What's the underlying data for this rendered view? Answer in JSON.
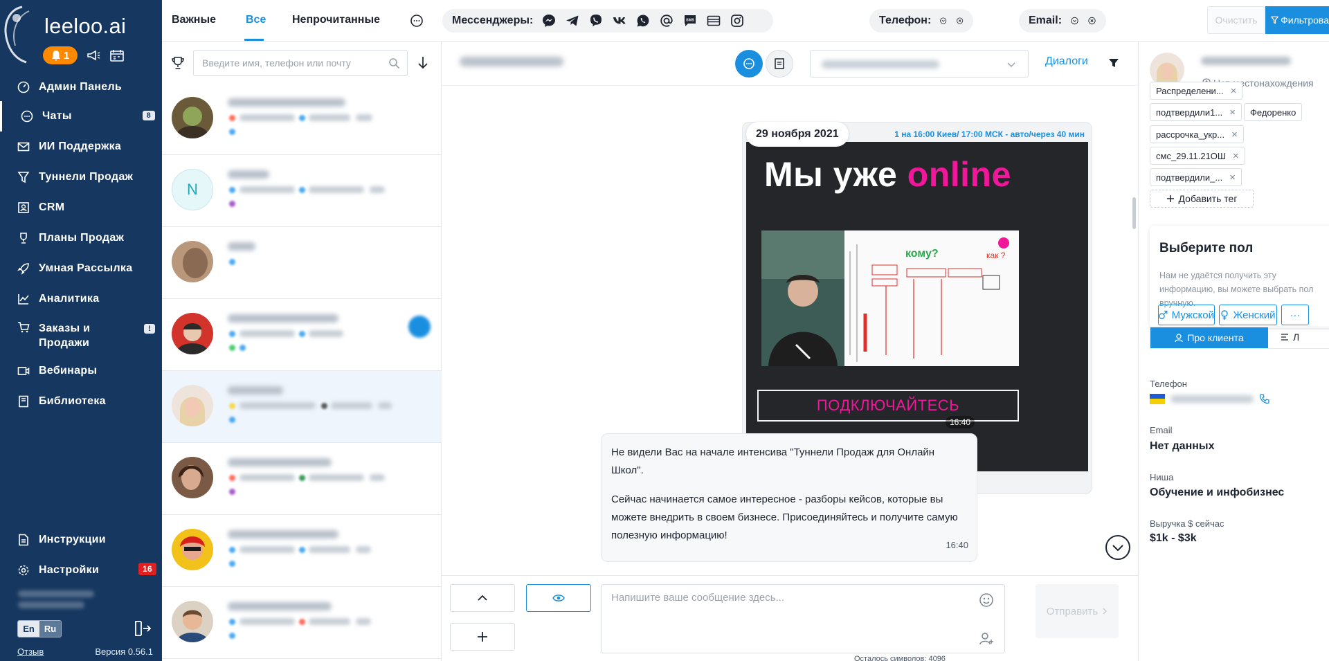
{
  "app": {
    "logo_text": "leeloo.ai",
    "notifications_count": "1"
  },
  "sidebar": {
    "items": [
      {
        "label": "Админ Панель",
        "icon": "speedometer-icon"
      },
      {
        "label": "Чаты",
        "icon": "chat-icon",
        "badge": "8",
        "active": true
      },
      {
        "label": "ИИ Поддержка",
        "icon": "mail-icon"
      },
      {
        "label": "Туннели Продаж",
        "icon": "funnel-icon"
      },
      {
        "label": "CRM",
        "icon": "crm-icon"
      },
      {
        "label": "Планы Продаж",
        "icon": "trophy-icon"
      },
      {
        "label": "Умная Рассылка",
        "icon": "rocket-icon"
      },
      {
        "label": "Аналитика",
        "icon": "chart-icon"
      },
      {
        "label": "Заказы и Продажи",
        "icon": "cart-icon",
        "badge": "!"
      },
      {
        "label": "Вебинары",
        "icon": "video-icon"
      },
      {
        "label": "Библиотека",
        "icon": "book-icon"
      }
    ],
    "bottom": [
      {
        "label": "Инструкции",
        "icon": "document-icon"
      },
      {
        "label": "Настройки",
        "icon": "gear-icon",
        "badge": "16"
      }
    ],
    "lang_en": "En",
    "lang_ru": "Ru",
    "feedback": "Отзыв",
    "version": "Версия 0.56.1"
  },
  "topbar": {
    "tabs": [
      "Важные",
      "Все",
      "Непрочитанные"
    ],
    "active_tab": "Все",
    "messengers_label": "Мессенджеры:",
    "messenger_icons": [
      "messenger-icon",
      "telegram-icon",
      "viber-icon",
      "vk-icon",
      "whatsapp-icon",
      "email-at-icon",
      "sms-icon",
      "wallet-icon",
      "instagram-icon"
    ],
    "phone_label": "Телефон:",
    "email_label": "Email:",
    "clear_label": "Очистить",
    "filter_label": "Фильтрова"
  },
  "chat_list": {
    "search_placeholder": "Введите имя, телефон или почту",
    "items": [
      {
        "avatar": "photo",
        "avatar_color": "#7a6a40"
      },
      {
        "avatar": "letter",
        "letter": "N"
      },
      {
        "avatar": "photo",
        "avatar_color": "#a07e62"
      },
      {
        "avatar": "photo",
        "avatar_color": "#c0392b"
      },
      {
        "avatar": "photo",
        "avatar_color": "#e8cfc0",
        "selected": true
      },
      {
        "avatar": "photo",
        "avatar_color": "#6b4a34"
      },
      {
        "avatar": "photo",
        "avatar_color": "#d8341e"
      },
      {
        "avatar": "photo",
        "avatar_color": "#e2c09d"
      }
    ]
  },
  "conversation": {
    "dialogs_label": "Диалоги",
    "date_chip": "29 ноября 2021",
    "image_caption": "1 на 16:00 Киев/ 17:00 МСК - авто/через 40 мин",
    "banner_title_white": "Мы уже",
    "banner_title_pink": "online",
    "whiteboard_title": "кому?",
    "whiteboard_note": "как ?",
    "banner_cta": "ПОДКЛЮЧАЙТЕСЬ",
    "image_time": "16:40",
    "text_message": {
      "line1": "Не видели Вас на начале интенсива \"Туннели Продаж для Онлайн Школ\".",
      "line2": "Сейчас начинается самое интересное - разборы кейсов, которые вы можете внедрить в своем бизнесе. Присоединяйтесь и получите самую полезную информацию!",
      "time": "16:40"
    },
    "composer_placeholder": "Напишите ваше сообщение здесь...",
    "chars_left": "Осталось символов: 4096",
    "send_label": "Отправить"
  },
  "client_panel": {
    "location": "Нет местонахождения",
    "tags": [
      "Распределени...",
      "подтвердили1...",
      "Федоренко",
      "рассрочка_укр...",
      "смс_29.11.21ОШ",
      "подтвердили_..."
    ],
    "add_tag": "Добавить тег",
    "gender_title": "Выберите пол",
    "gender_hint": "Нам не удаётся получить эту информацию, вы можете выбрать пол вручную.",
    "male": "Мужской",
    "female": "Женский",
    "more": "···",
    "tab_client": "Про клиента",
    "tab_other": "Л",
    "phone_label": "Телефон",
    "email_label": "Email",
    "email_value": "Нет данных",
    "niche_label": "Ниша",
    "niche_value": "Обучение и инфобизнес",
    "revenue_label": "Выручка $ сейчас",
    "revenue_value": "$1k - $3k"
  },
  "colors": {
    "sidebar": "#16375f",
    "accent": "#1a8fe0",
    "pink": "#f0179a",
    "orange": "#ff8a00",
    "red_badge": "#e02020"
  }
}
